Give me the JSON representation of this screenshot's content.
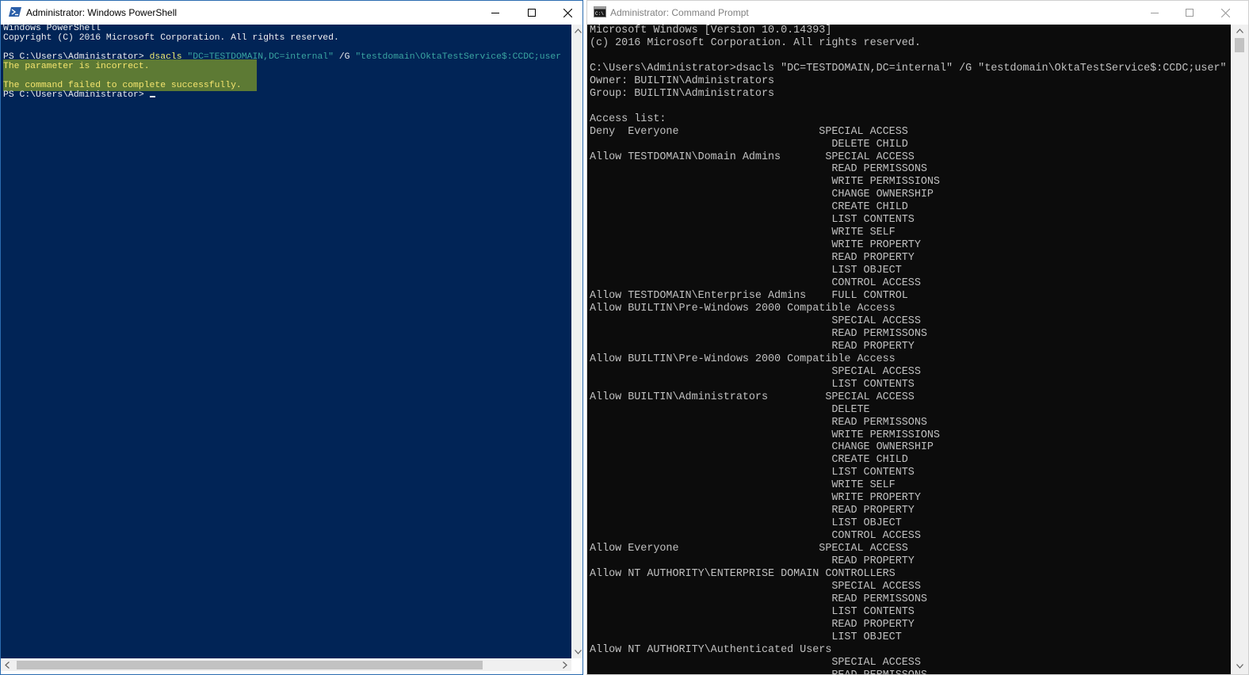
{
  "powershell": {
    "title": "Administrator: Windows PowerShell",
    "lines": [
      "Windows PowerShell",
      "Copyright (C) 2016 Microsoft Corporation. All rights reserved."
    ],
    "prompt1": "PS C:\\Users\\Administrator> ",
    "cmd_word": "dsacls",
    "arg1": "\"DC=TESTDOMAIN,DC=internal\"",
    "flag": "/G",
    "arg2": "\"testdomain\\OktaTestService$:CCDC;user",
    "error1": "The parameter is incorrect.",
    "error2": "The command failed to complete successfully.",
    "prompt2": "PS C:\\Users\\Administrator> "
  },
  "cmd": {
    "title": "Administrator: Command Prompt",
    "lines": [
      "Microsoft Windows [Version 10.0.14393]",
      "(c) 2016 Microsoft Corporation. All rights reserved.",
      "",
      "C:\\Users\\Administrator>dsacls \"DC=TESTDOMAIN,DC=internal\" /G \"testdomain\\OktaTestService$:CCDC;user\"",
      "Owner: BUILTIN\\Administrators",
      "Group: BUILTIN\\Administrators",
      "",
      "Access list:",
      "Deny  Everyone                      SPECIAL ACCESS",
      "                                      DELETE CHILD",
      "Allow TESTDOMAIN\\Domain Admins       SPECIAL ACCESS",
      "                                      READ PERMISSONS",
      "                                      WRITE PERMISSIONS",
      "                                      CHANGE OWNERSHIP",
      "                                      CREATE CHILD",
      "                                      LIST CONTENTS",
      "                                      WRITE SELF",
      "                                      WRITE PROPERTY",
      "                                      READ PROPERTY",
      "                                      LIST OBJECT",
      "                                      CONTROL ACCESS",
      "Allow TESTDOMAIN\\Enterprise Admins    FULL CONTROL",
      "Allow BUILTIN\\Pre-Windows 2000 Compatible Access",
      "                                      SPECIAL ACCESS",
      "                                      READ PERMISSONS",
      "                                      READ PROPERTY",
      "Allow BUILTIN\\Pre-Windows 2000 Compatible Access",
      "                                      SPECIAL ACCESS",
      "                                      LIST CONTENTS",
      "Allow BUILTIN\\Administrators         SPECIAL ACCESS",
      "                                      DELETE",
      "                                      READ PERMISSONS",
      "                                      WRITE PERMISSIONS",
      "                                      CHANGE OWNERSHIP",
      "                                      CREATE CHILD",
      "                                      LIST CONTENTS",
      "                                      WRITE SELF",
      "                                      WRITE PROPERTY",
      "                                      READ PROPERTY",
      "                                      LIST OBJECT",
      "                                      CONTROL ACCESS",
      "Allow Everyone                      SPECIAL ACCESS",
      "                                      READ PROPERTY",
      "Allow NT AUTHORITY\\ENTERPRISE DOMAIN CONTROLLERS",
      "                                      SPECIAL ACCESS",
      "                                      READ PERMISSONS",
      "                                      LIST CONTENTS",
      "                                      READ PROPERTY",
      "                                      LIST OBJECT",
      "Allow NT AUTHORITY\\Authenticated Users",
      "                                      SPECIAL ACCESS",
      "                                      READ PERMISSONS"
    ]
  },
  "colors": {
    "powershell_bg": "#012456",
    "cmd_bg": "#0c0c0c",
    "error_highlight": "#5d7a34",
    "error_text": "#f5e56e"
  },
  "icons": {
    "powershell": "powershell-icon",
    "cmd": "cmd-icon"
  }
}
